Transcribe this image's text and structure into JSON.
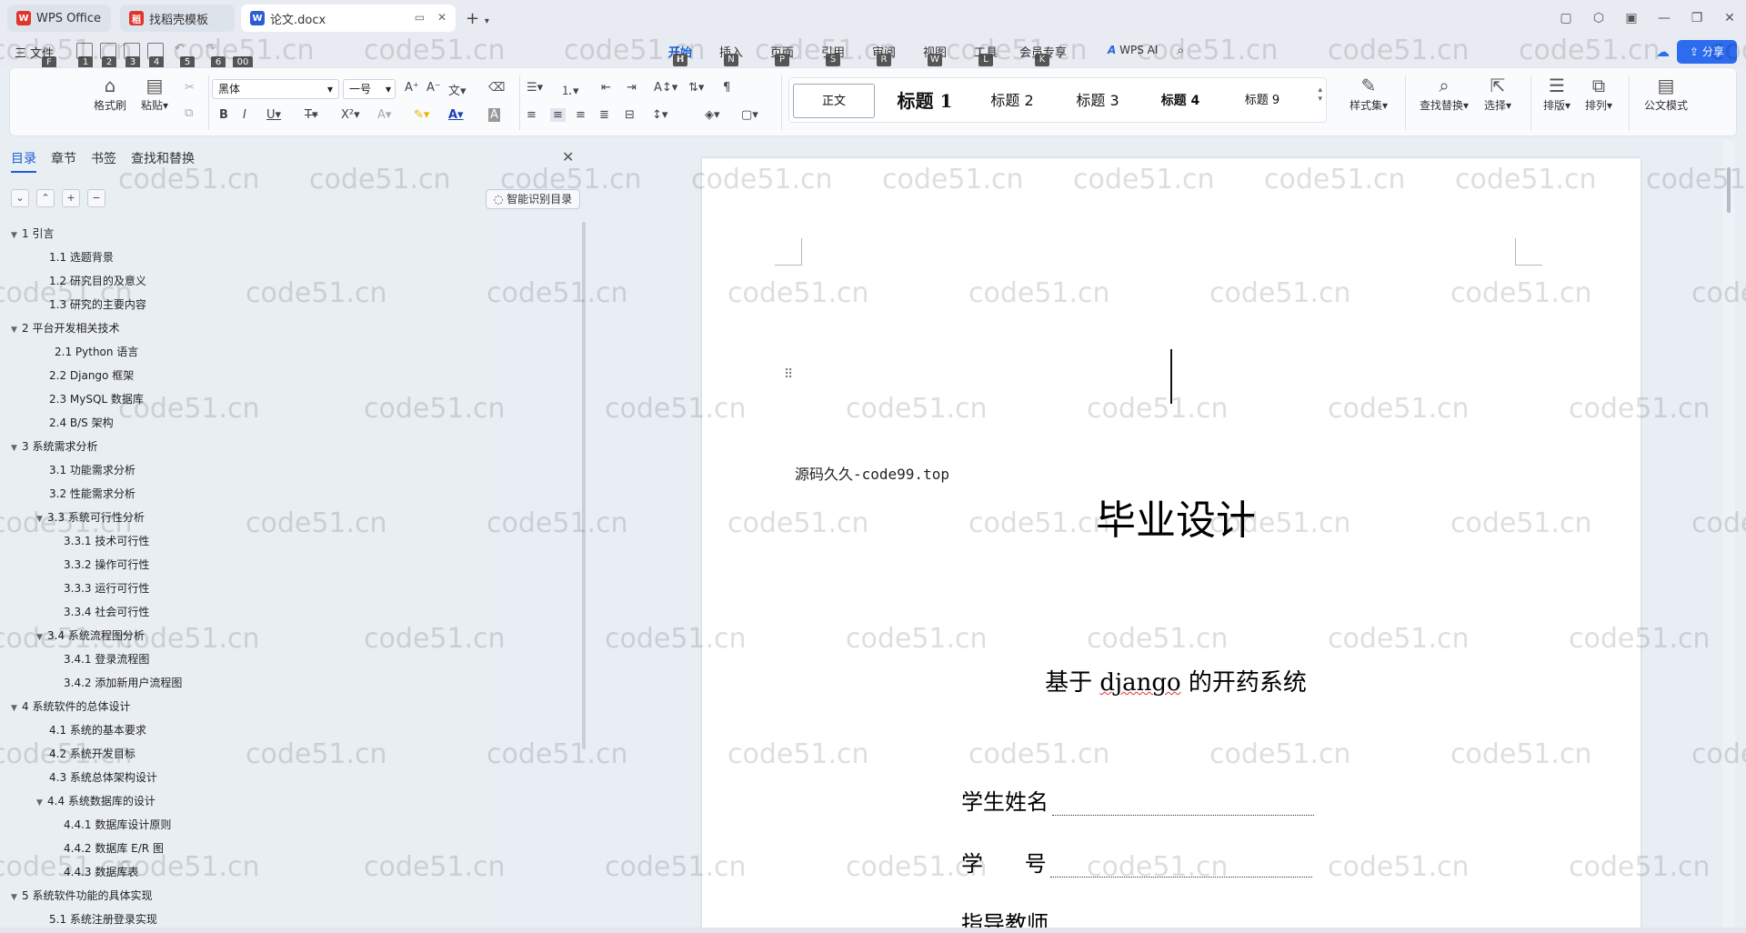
{
  "tabs": [
    {
      "label": "WPS Office",
      "icon": "wps-logo-icon"
    },
    {
      "label": "找稻壳模板",
      "icon": "docer-icon"
    },
    {
      "label": "论文.docx",
      "icon": "word-doc-icon"
    }
  ],
  "menu": {
    "file_label": "三 文件",
    "quick_keys": [
      "F",
      "1",
      "2",
      "3",
      "4",
      "5",
      "6",
      "00"
    ],
    "tabs": [
      {
        "label": "开始",
        "key": "H"
      },
      {
        "label": "插入",
        "key": "N"
      },
      {
        "label": "页面",
        "key": "P"
      },
      {
        "label": "引用",
        "key": "S"
      },
      {
        "label": "审阅",
        "key": "R"
      },
      {
        "label": "视图",
        "key": "W"
      },
      {
        "label": "工具",
        "key": "L"
      },
      {
        "label": "会员专享",
        "key": "K"
      }
    ],
    "wps_ai_label": "WPS AI",
    "share_label": "分享"
  },
  "ribbon": {
    "format_painter": "格式刷",
    "paste": "粘贴",
    "font_name": "黑体",
    "font_size": "一号",
    "styles": [
      "正文",
      "标题 1",
      "标题 2",
      "标题 3",
      "标题 4",
      "标题 9"
    ],
    "style_set": "样式集",
    "find_replace": "查找替换",
    "select": "选择",
    "layout": "排版",
    "arrange": "排列",
    "official_mode": "公文模式"
  },
  "nav": {
    "tabs": [
      "目录",
      "章节",
      "书签",
      "查找和替换"
    ],
    "smart_toc_label": "智能识别目录",
    "toc": [
      {
        "text": "1  引言",
        "level": 0,
        "expandable": true
      },
      {
        "text": "1.1  选题背景",
        "level": 1
      },
      {
        "text": "1.2  研究目的及意义",
        "level": 1
      },
      {
        "text": "1.3  研究的主要内容",
        "level": 1
      },
      {
        "text": "2  平台开发相关技术",
        "level": 0,
        "expandable": true
      },
      {
        "text": "2.1 Python 语言",
        "level": 1
      },
      {
        "text": "2.2 Django 框架",
        "level": 1
      },
      {
        "text": "2.3 MySQL 数据库",
        "level": 1
      },
      {
        "text": "2.4 B/S 架构",
        "level": 1
      },
      {
        "text": "3 系统需求分析",
        "level": 0,
        "expandable": true
      },
      {
        "text": "3.1  功能需求分析",
        "level": 1
      },
      {
        "text": "3.2 性能需求分析",
        "level": 1
      },
      {
        "text": "3.3  系统可行性分析",
        "level": 1,
        "expandable": true
      },
      {
        "text": "3.3.1  技术可行性",
        "level": 2
      },
      {
        "text": "3.3.2  操作可行性",
        "level": 2
      },
      {
        "text": "3.3.3 运行可行性",
        "level": 2
      },
      {
        "text": "3.3.4 社会可行性",
        "level": 2
      },
      {
        "text": "3.4 系统流程图分析",
        "level": 1,
        "expandable": true
      },
      {
        "text": "3.4.1  登录流程图",
        "level": 2
      },
      {
        "text": "3.4.2  添加新用户流程图",
        "level": 2
      },
      {
        "text": "4  系统软件的总体设计",
        "level": 0,
        "expandable": true
      },
      {
        "text": "4.1 系统的基本要求",
        "level": 1
      },
      {
        "text": "4.2  系统开发目标",
        "level": 1
      },
      {
        "text": "4.3  系统总体架构设计",
        "level": 1
      },
      {
        "text": "4.4  系统数据库的设计",
        "level": 1,
        "expandable": true
      },
      {
        "text": "4.4.1 数据库设计原则",
        "level": 2
      },
      {
        "text": "4.4.2 数据库 E/R 图",
        "level": 2
      },
      {
        "text": "4.4.3  数据库表",
        "level": 2
      },
      {
        "text": "5  系统软件功能的具体实现",
        "level": 0,
        "expandable": true
      },
      {
        "text": "5.1 系统注册登录实现",
        "level": 1
      }
    ]
  },
  "document": {
    "source_line": "源码久久-code99.top",
    "title": "毕业设计",
    "subtitle_pre": "基于 ",
    "subtitle_word": "django",
    "subtitle_post": " 的开药系统",
    "fields": [
      "学生姓名",
      "学      号",
      "指导教师"
    ]
  },
  "watermark_text": "code51.cn",
  "colors": {
    "accent": "#1a5fd8",
    "share": "#2d6bef"
  }
}
